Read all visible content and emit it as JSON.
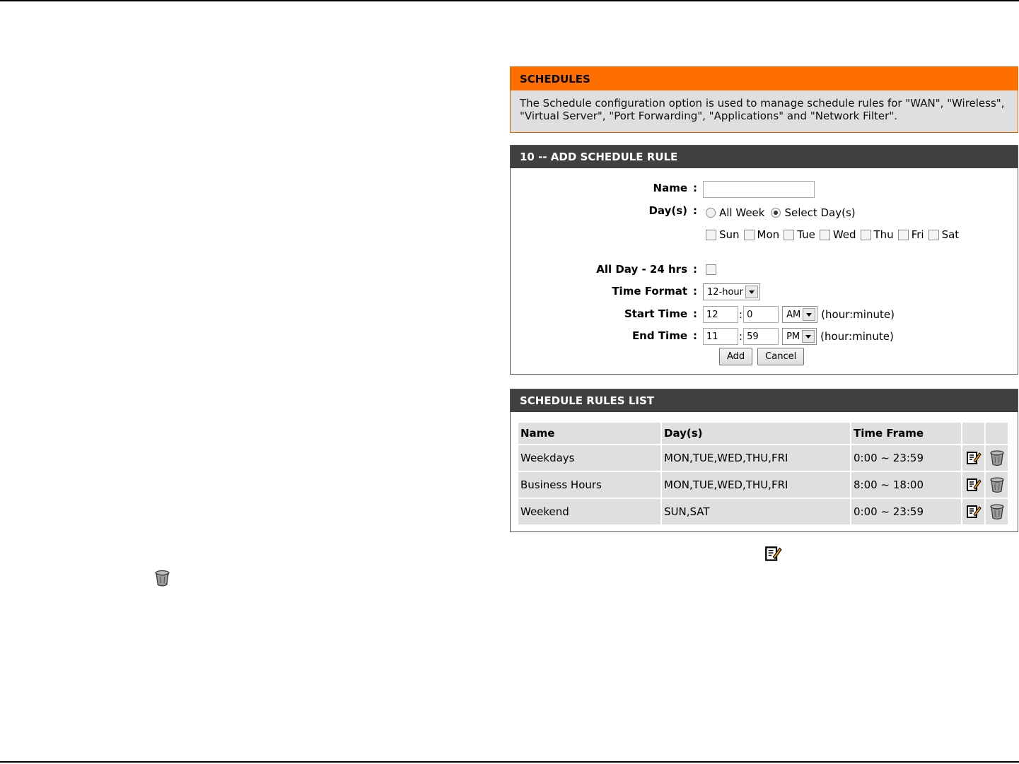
{
  "schedules": {
    "title": "SCHEDULES",
    "description": "The Schedule configuration option is used to manage schedule rules for \"WAN\", \"Wireless\", \"Virtual Server\", \"Port Forwarding\", \"Applications\" and \"Network Filter\"."
  },
  "add_rule": {
    "title": "10 -- ADD SCHEDULE RULE",
    "name_label": "Name",
    "name_value": "",
    "days_label": "Day(s)",
    "all_week_label": "All Week",
    "select_days_label": "Select Day(s)",
    "selected_days_mode": "Select Day(s)",
    "days": [
      "Sun",
      "Mon",
      "Tue",
      "Wed",
      "Thu",
      "Fri",
      "Sat"
    ],
    "all_day_label": "All Day - 24 hrs",
    "time_format_label": "Time Format",
    "time_format_value": "12-hour",
    "start_time_label": "Start Time",
    "start_hour": "12",
    "start_minute": "0",
    "start_ampm": "AM",
    "end_time_label": "End Time",
    "end_hour": "11",
    "end_minute": "59",
    "end_ampm": "PM",
    "hint": "(hour:minute)",
    "colon": ":",
    "add_button": "Add",
    "cancel_button": "Cancel"
  },
  "rules_list": {
    "title": "SCHEDULE RULES LIST",
    "headers": {
      "name": "Name",
      "days": "Day(s)",
      "time_frame": "Time Frame"
    },
    "rows": [
      {
        "name": "Weekdays",
        "days": "MON,TUE,WED,THU,FRI",
        "time_frame": "0:00 ~ 23:59"
      },
      {
        "name": "Business Hours",
        "days": "MON,TUE,WED,THU,FRI",
        "time_frame": "8:00 ~ 18:00"
      },
      {
        "name": "Weekend",
        "days": "SUN,SAT",
        "time_frame": "0:00 ~ 23:59"
      }
    ]
  },
  "icons": {
    "edit": "edit-icon",
    "delete": "trash-icon"
  },
  "colors": {
    "orange_header": "#ff6f00",
    "dark_header": "#404040",
    "panel_gray": "#dfdfdf"
  }
}
